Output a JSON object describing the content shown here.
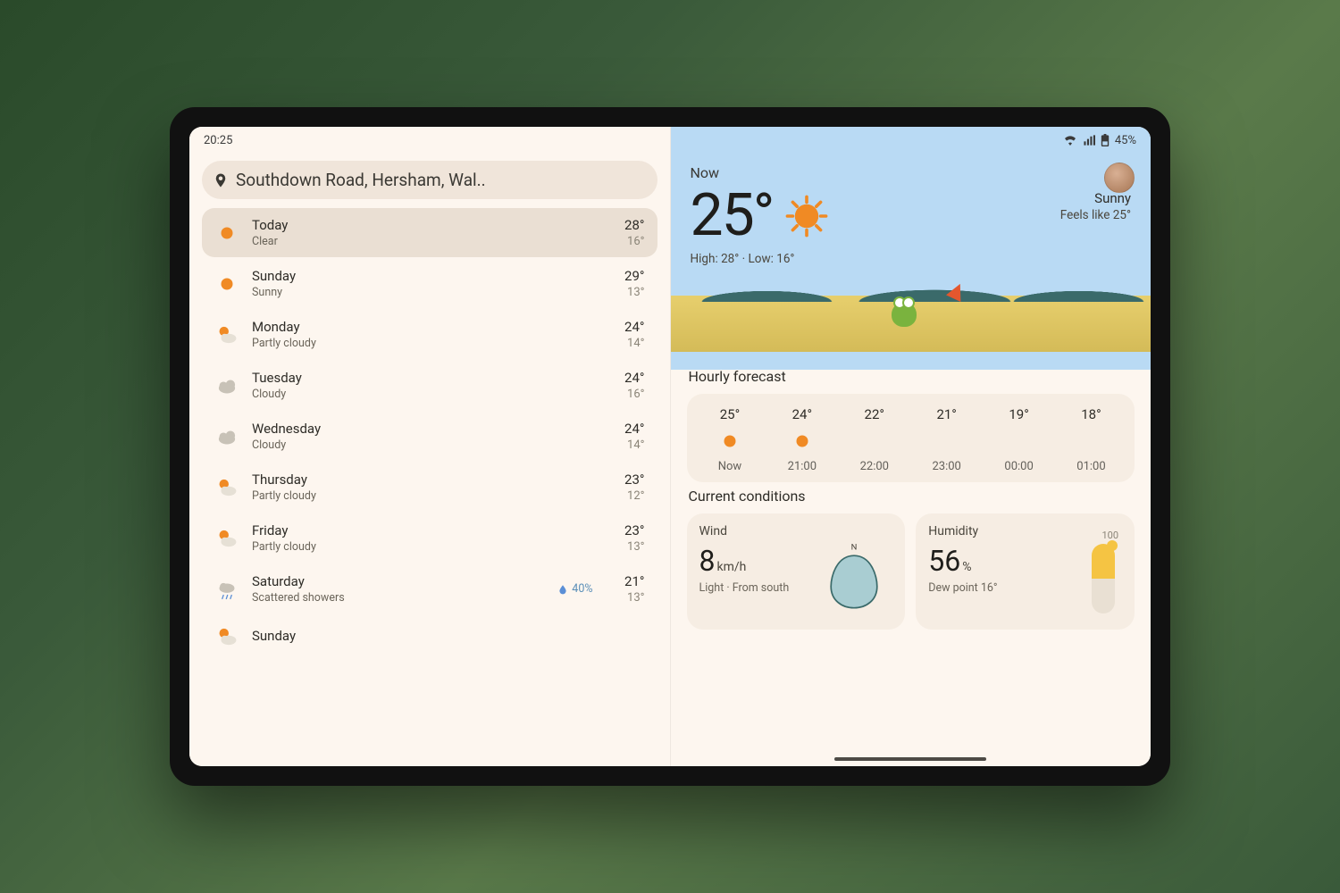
{
  "statusbar": {
    "time": "20:25",
    "battery": "45%"
  },
  "location": "Southdown Road, Hersham, Wal..",
  "days": [
    {
      "name": "Today",
      "cond": "Clear",
      "hi": "28°",
      "lo": "16°",
      "icon": "sun",
      "selected": true,
      "precip": ""
    },
    {
      "name": "Sunday",
      "cond": "Sunny",
      "hi": "29°",
      "lo": "13°",
      "icon": "sun",
      "precip": ""
    },
    {
      "name": "Monday",
      "cond": "Partly cloudy",
      "hi": "24°",
      "lo": "14°",
      "icon": "partly",
      "precip": ""
    },
    {
      "name": "Tuesday",
      "cond": "Cloudy",
      "hi": "24°",
      "lo": "16°",
      "icon": "cloud",
      "precip": ""
    },
    {
      "name": "Wednesday",
      "cond": "Cloudy",
      "hi": "24°",
      "lo": "14°",
      "icon": "cloud",
      "precip": ""
    },
    {
      "name": "Thursday",
      "cond": "Partly cloudy",
      "hi": "23°",
      "lo": "12°",
      "icon": "partly",
      "precip": ""
    },
    {
      "name": "Friday",
      "cond": "Partly cloudy",
      "hi": "23°",
      "lo": "13°",
      "icon": "partly",
      "precip": ""
    },
    {
      "name": "Saturday",
      "cond": "Scattered showers",
      "hi": "21°",
      "lo": "13°",
      "icon": "rain",
      "precip": "40%"
    },
    {
      "name": "Sunday",
      "cond": "",
      "hi": "",
      "lo": "",
      "icon": "partly",
      "precip": ""
    }
  ],
  "now": {
    "label": "Now",
    "temp": "25°",
    "summary": "Sunny",
    "feels": "Feels like 25°",
    "hilo": "High: 28° · Low: 16°"
  },
  "sections": {
    "hourly": "Hourly forecast",
    "conditions": "Current conditions"
  },
  "hourly": [
    {
      "temp": "25°",
      "time": "Now",
      "icon": "sun"
    },
    {
      "temp": "24°",
      "time": "21:00",
      "icon": "sun"
    },
    {
      "temp": "22°",
      "time": "22:00",
      "icon": "moon"
    },
    {
      "temp": "21°",
      "time": "23:00",
      "icon": "moon"
    },
    {
      "temp": "19°",
      "time": "00:00",
      "icon": "moon"
    },
    {
      "temp": "18°",
      "time": "01:00",
      "icon": "moon"
    }
  ],
  "wind": {
    "label": "Wind",
    "value": "8",
    "unit": "km/h",
    "desc": "Light · From south",
    "direction": "N"
  },
  "humidity": {
    "label": "Humidity",
    "value": "56",
    "unit": "%",
    "desc": "Dew point 16°",
    "scaleTop": "100"
  }
}
